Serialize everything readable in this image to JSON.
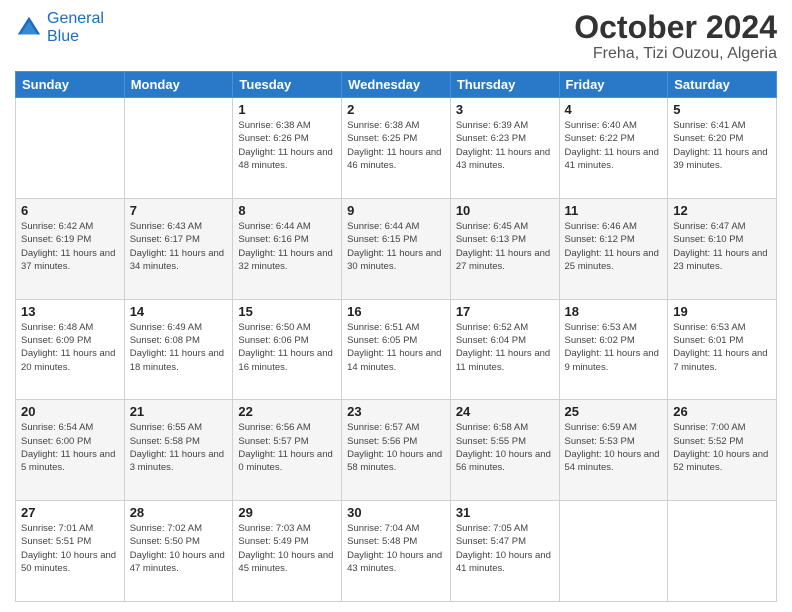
{
  "header": {
    "logo_line1": "General",
    "logo_line2": "Blue",
    "month": "October 2024",
    "location": "Freha, Tizi Ouzou, Algeria"
  },
  "days_of_week": [
    "Sunday",
    "Monday",
    "Tuesday",
    "Wednesday",
    "Thursday",
    "Friday",
    "Saturday"
  ],
  "weeks": [
    [
      {
        "num": "",
        "detail": ""
      },
      {
        "num": "",
        "detail": ""
      },
      {
        "num": "1",
        "detail": "Sunrise: 6:38 AM\nSunset: 6:26 PM\nDaylight: 11 hours and 48 minutes."
      },
      {
        "num": "2",
        "detail": "Sunrise: 6:38 AM\nSunset: 6:25 PM\nDaylight: 11 hours and 46 minutes."
      },
      {
        "num": "3",
        "detail": "Sunrise: 6:39 AM\nSunset: 6:23 PM\nDaylight: 11 hours and 43 minutes."
      },
      {
        "num": "4",
        "detail": "Sunrise: 6:40 AM\nSunset: 6:22 PM\nDaylight: 11 hours and 41 minutes."
      },
      {
        "num": "5",
        "detail": "Sunrise: 6:41 AM\nSunset: 6:20 PM\nDaylight: 11 hours and 39 minutes."
      }
    ],
    [
      {
        "num": "6",
        "detail": "Sunrise: 6:42 AM\nSunset: 6:19 PM\nDaylight: 11 hours and 37 minutes."
      },
      {
        "num": "7",
        "detail": "Sunrise: 6:43 AM\nSunset: 6:17 PM\nDaylight: 11 hours and 34 minutes."
      },
      {
        "num": "8",
        "detail": "Sunrise: 6:44 AM\nSunset: 6:16 PM\nDaylight: 11 hours and 32 minutes."
      },
      {
        "num": "9",
        "detail": "Sunrise: 6:44 AM\nSunset: 6:15 PM\nDaylight: 11 hours and 30 minutes."
      },
      {
        "num": "10",
        "detail": "Sunrise: 6:45 AM\nSunset: 6:13 PM\nDaylight: 11 hours and 27 minutes."
      },
      {
        "num": "11",
        "detail": "Sunrise: 6:46 AM\nSunset: 6:12 PM\nDaylight: 11 hours and 25 minutes."
      },
      {
        "num": "12",
        "detail": "Sunrise: 6:47 AM\nSunset: 6:10 PM\nDaylight: 11 hours and 23 minutes."
      }
    ],
    [
      {
        "num": "13",
        "detail": "Sunrise: 6:48 AM\nSunset: 6:09 PM\nDaylight: 11 hours and 20 minutes."
      },
      {
        "num": "14",
        "detail": "Sunrise: 6:49 AM\nSunset: 6:08 PM\nDaylight: 11 hours and 18 minutes."
      },
      {
        "num": "15",
        "detail": "Sunrise: 6:50 AM\nSunset: 6:06 PM\nDaylight: 11 hours and 16 minutes."
      },
      {
        "num": "16",
        "detail": "Sunrise: 6:51 AM\nSunset: 6:05 PM\nDaylight: 11 hours and 14 minutes."
      },
      {
        "num": "17",
        "detail": "Sunrise: 6:52 AM\nSunset: 6:04 PM\nDaylight: 11 hours and 11 minutes."
      },
      {
        "num": "18",
        "detail": "Sunrise: 6:53 AM\nSunset: 6:02 PM\nDaylight: 11 hours and 9 minutes."
      },
      {
        "num": "19",
        "detail": "Sunrise: 6:53 AM\nSunset: 6:01 PM\nDaylight: 11 hours and 7 minutes."
      }
    ],
    [
      {
        "num": "20",
        "detail": "Sunrise: 6:54 AM\nSunset: 6:00 PM\nDaylight: 11 hours and 5 minutes."
      },
      {
        "num": "21",
        "detail": "Sunrise: 6:55 AM\nSunset: 5:58 PM\nDaylight: 11 hours and 3 minutes."
      },
      {
        "num": "22",
        "detail": "Sunrise: 6:56 AM\nSunset: 5:57 PM\nDaylight: 11 hours and 0 minutes."
      },
      {
        "num": "23",
        "detail": "Sunrise: 6:57 AM\nSunset: 5:56 PM\nDaylight: 10 hours and 58 minutes."
      },
      {
        "num": "24",
        "detail": "Sunrise: 6:58 AM\nSunset: 5:55 PM\nDaylight: 10 hours and 56 minutes."
      },
      {
        "num": "25",
        "detail": "Sunrise: 6:59 AM\nSunset: 5:53 PM\nDaylight: 10 hours and 54 minutes."
      },
      {
        "num": "26",
        "detail": "Sunrise: 7:00 AM\nSunset: 5:52 PM\nDaylight: 10 hours and 52 minutes."
      }
    ],
    [
      {
        "num": "27",
        "detail": "Sunrise: 7:01 AM\nSunset: 5:51 PM\nDaylight: 10 hours and 50 minutes."
      },
      {
        "num": "28",
        "detail": "Sunrise: 7:02 AM\nSunset: 5:50 PM\nDaylight: 10 hours and 47 minutes."
      },
      {
        "num": "29",
        "detail": "Sunrise: 7:03 AM\nSunset: 5:49 PM\nDaylight: 10 hours and 45 minutes."
      },
      {
        "num": "30",
        "detail": "Sunrise: 7:04 AM\nSunset: 5:48 PM\nDaylight: 10 hours and 43 minutes."
      },
      {
        "num": "31",
        "detail": "Sunrise: 7:05 AM\nSunset: 5:47 PM\nDaylight: 10 hours and 41 minutes."
      },
      {
        "num": "",
        "detail": ""
      },
      {
        "num": "",
        "detail": ""
      }
    ]
  ]
}
